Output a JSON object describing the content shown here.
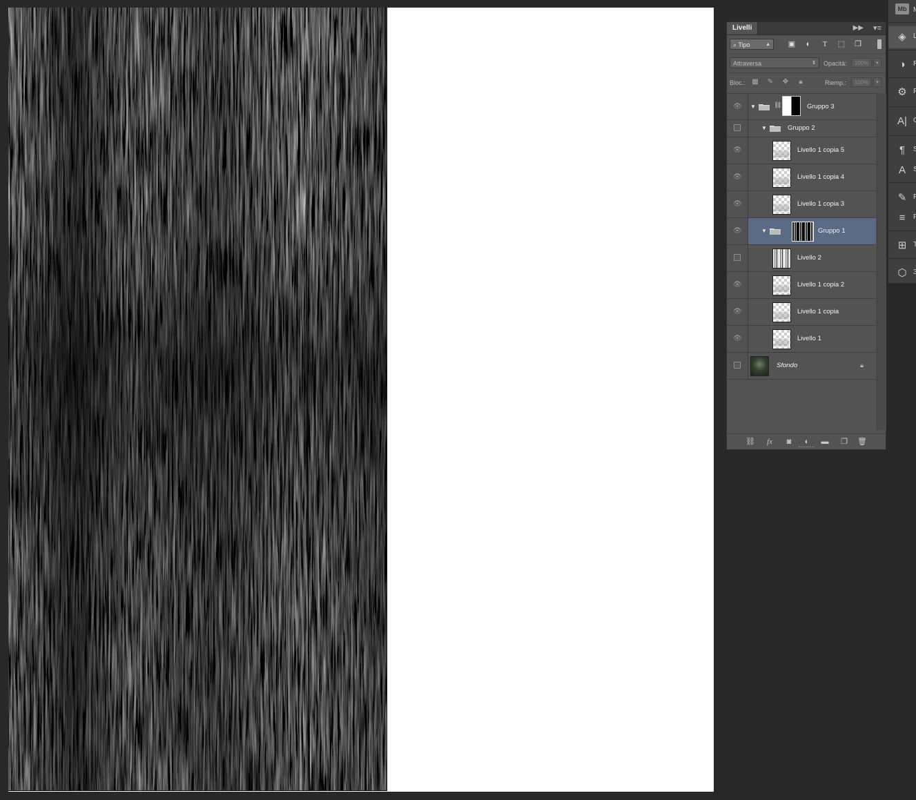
{
  "layers_panel": {
    "tab_label": "Livelli",
    "filter": {
      "label": "Tipo"
    },
    "blend_mode": "Attraversa",
    "opacity": {
      "label": "Opacità:",
      "value": "100%"
    },
    "lock": {
      "label": "Bloc.:"
    },
    "fill": {
      "label": "Riemp.:",
      "value": "100%"
    },
    "layers": [
      {
        "name": "Gruppo 3",
        "kind": "group",
        "visible": true,
        "expanded": true,
        "has_mask": true
      },
      {
        "name": "Gruppo 2",
        "kind": "group",
        "visible": false,
        "expanded": true
      },
      {
        "name": "Livello 1 copia 5",
        "kind": "layer",
        "visible": true
      },
      {
        "name": "Livello 1 copia 4",
        "kind": "layer",
        "visible": true
      },
      {
        "name": "Livello 1 copia 3",
        "kind": "layer",
        "visible": true
      },
      {
        "name": "Gruppo 1",
        "kind": "group",
        "visible": true,
        "expanded": true,
        "selected": true,
        "has_mask": true
      },
      {
        "name": "Livello 2",
        "kind": "layer",
        "visible": false
      },
      {
        "name": "Livello 1 copia 2",
        "kind": "layer",
        "visible": true
      },
      {
        "name": "Livello 1 copia",
        "kind": "layer",
        "visible": true
      },
      {
        "name": "Livello 1",
        "kind": "layer",
        "visible": true
      },
      {
        "name": "Sfondo",
        "kind": "background",
        "visible": false,
        "locked": true
      }
    ],
    "footer_icons": [
      "link-icon",
      "fx-icon",
      "mask-icon",
      "adjustment-icon",
      "group-folder-icon",
      "new-layer-icon",
      "trash-icon"
    ]
  },
  "dock": {
    "items": [
      {
        "icon": "mini-bridge-icon",
        "badge": "Mb",
        "letter": "M"
      },
      {
        "icon": "layers-icon",
        "letter": "L"
      },
      {
        "icon": "adjustments-icon",
        "letter": "R"
      },
      {
        "icon": "properties-icon",
        "letter": "P"
      },
      {
        "icon": "character-icon",
        "letter": "C"
      },
      {
        "icon": "paragraph-styles-icon",
        "letter": "S"
      },
      {
        "icon": "character-styles-icon",
        "letter": "S"
      },
      {
        "icon": "brush-icon",
        "letter": "P"
      },
      {
        "icon": "brush-presets-icon",
        "letter": "P"
      },
      {
        "icon": "timeline-icon",
        "letter": "T"
      },
      {
        "icon": "3d-icon",
        "letter": "3"
      }
    ]
  },
  "colors": {
    "app_background": "#282828",
    "panel": "#535353",
    "selected_layer": "#5c6b85",
    "document": "#ffffff"
  }
}
